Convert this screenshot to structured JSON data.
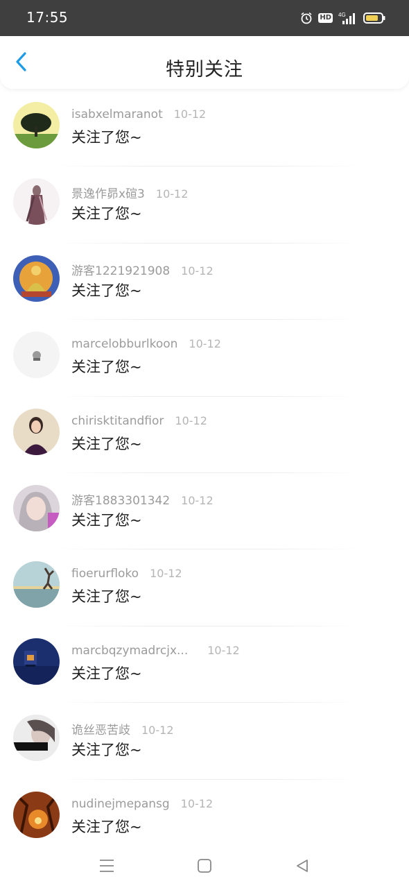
{
  "status_bar": {
    "time": "17:55",
    "hd_label": "HD",
    "network_label": "4G",
    "icons": [
      "alarm-icon",
      "signal-icon",
      "battery-icon"
    ],
    "battery_color": "#f0cf55"
  },
  "header": {
    "title": "特别关注",
    "back_icon": "chevron-left-icon",
    "back_color": "#1e9be6"
  },
  "list": [
    {
      "username": "isabxelmaranot",
      "date": "10-12",
      "message": "关注了您~"
    },
    {
      "username": "景逸作昴x碹3",
      "date": "10-12",
      "message": "关注了您~"
    },
    {
      "username": "游客1221921908",
      "date": "10-12",
      "message": "关注了您~"
    },
    {
      "username": "marcelobburlkoon",
      "date": "10-12",
      "message": "关注了您~"
    },
    {
      "username": "chirisktitandfior",
      "date": "10-12",
      "message": "关注了您~"
    },
    {
      "username": "游客1883301342",
      "date": "10-12",
      "message": "关注了您~"
    },
    {
      "username": "fioerurfloko",
      "date": "10-12",
      "message": "关注了您~"
    },
    {
      "username": "marcbqzymadrcjx...",
      "date": "10-12",
      "message": "关注了您~"
    },
    {
      "username": "诡丝恶苦歧",
      "date": "10-12",
      "message": "关注了您~"
    },
    {
      "username": "nudinejmepansg",
      "date": "10-12",
      "message": "关注了您~"
    }
  ],
  "nav_bar": {
    "icons": [
      "menu-icon",
      "home-icon",
      "back-triangle-icon"
    ]
  }
}
